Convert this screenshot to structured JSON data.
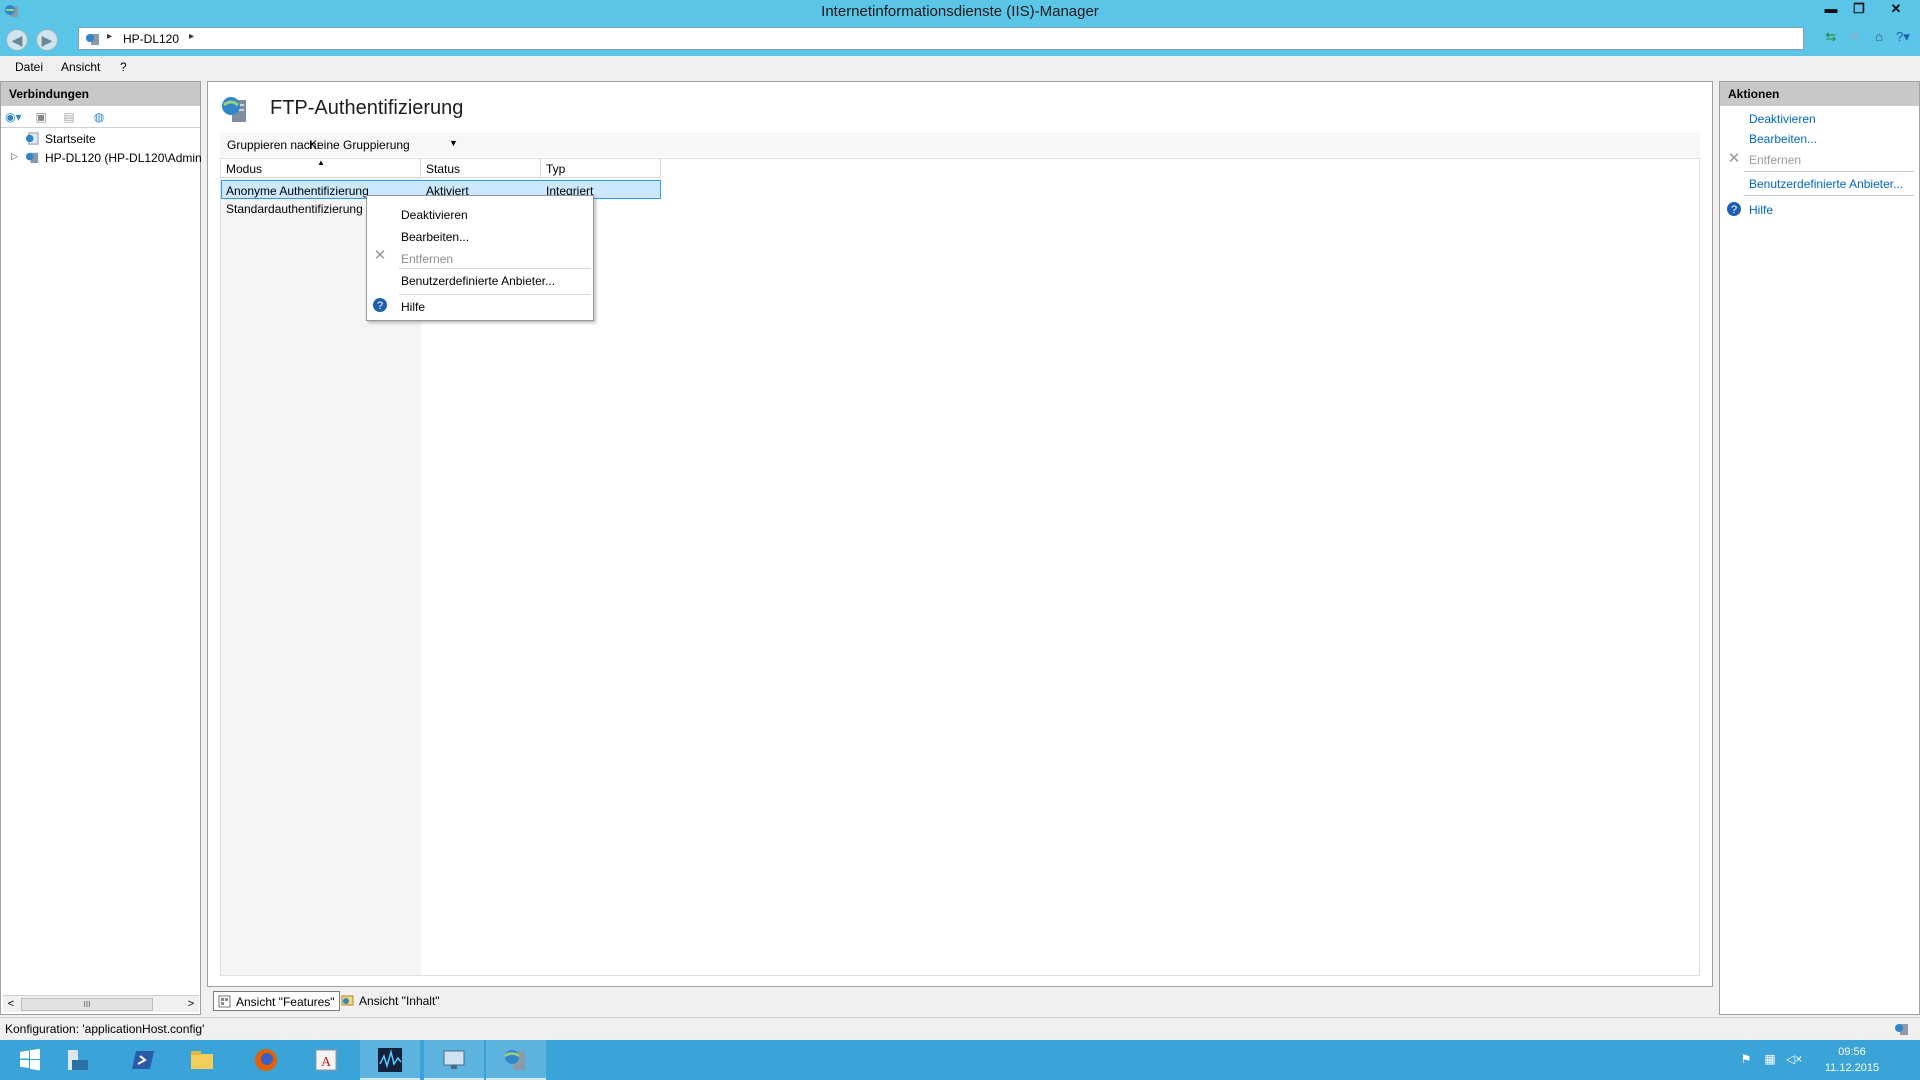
{
  "window": {
    "title": "Internetinformationsdienste (IIS)-Manager",
    "controls": {
      "minimize": "▬",
      "restore": "❐",
      "close": "✕"
    }
  },
  "address": {
    "crumb": "HP-DL120",
    "separator": "▸"
  },
  "menu": {
    "file": "Datei",
    "view": "Ansicht",
    "help": "?"
  },
  "connections": {
    "header": "Verbindungen",
    "tree": [
      {
        "label": "Startseite",
        "icon": "startpage-icon"
      },
      {
        "label": "HP-DL120 (HP-DL120\\Admin",
        "icon": "server-icon"
      }
    ],
    "scroll_thumb": "III"
  },
  "feature": {
    "title": "FTP-Authentifizierung",
    "group_label": "Gruppieren nach:",
    "group_value": "Keine Gruppierung",
    "columns": [
      "Modus",
      "Status",
      "Typ"
    ],
    "rows": [
      {
        "mode": "Anonyme Authentifizierung",
        "status": "Aktiviert",
        "type": "Integriert",
        "selected": true
      },
      {
        "mode": "Standardauthentifizierung",
        "status": "",
        "type": "",
        "selected": false
      }
    ]
  },
  "context_menu": {
    "deactivate": "Deaktivieren",
    "edit": "Bearbeiten...",
    "remove": "Entfernen",
    "custom_providers": "Benutzerdefinierte Anbieter...",
    "help": "Hilfe"
  },
  "view_tabs": {
    "features": "Ansicht \"Features\"",
    "content": "Ansicht \"Inhalt\""
  },
  "actions": {
    "header": "Aktionen",
    "deactivate": "Deaktivieren",
    "edit": "Bearbeiten...",
    "remove": "Entfernen",
    "custom_providers": "Benutzerdefinierte Anbieter...",
    "help": "Hilfe"
  },
  "status": {
    "text": "Konfiguration: 'applicationHost.config'"
  },
  "taskbar": {
    "items": [
      "start-icon",
      "server-manager-icon",
      "powershell-icon",
      "explorer-icon",
      "firefox-icon",
      "filezilla-icon",
      "gridvis-icon",
      "remote-desktop-icon",
      "iis-manager-icon"
    ],
    "time": "09:56",
    "date": "11.12.2015"
  },
  "colors": {
    "accent": "#5bc5e8",
    "taskbar": "#3aa3d8",
    "link": "#0066cc",
    "selection": "#cce8ff"
  }
}
